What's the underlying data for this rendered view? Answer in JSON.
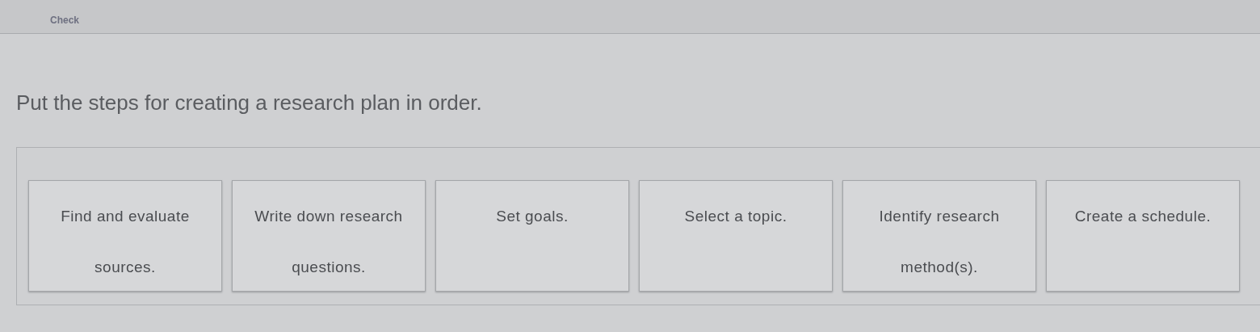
{
  "header": {
    "label": "Check"
  },
  "prompt": "Put the steps for creating a research plan in order.",
  "tiles": [
    {
      "lines": [
        "Find and evaluate",
        "sources."
      ]
    },
    {
      "lines": [
        "Write down research",
        "questions."
      ]
    },
    {
      "lines": [
        "Set goals."
      ]
    },
    {
      "lines": [
        "Select a topic."
      ]
    },
    {
      "lines": [
        "Identify research",
        "method(s)."
      ]
    },
    {
      "lines": [
        "Create a schedule."
      ]
    }
  ]
}
